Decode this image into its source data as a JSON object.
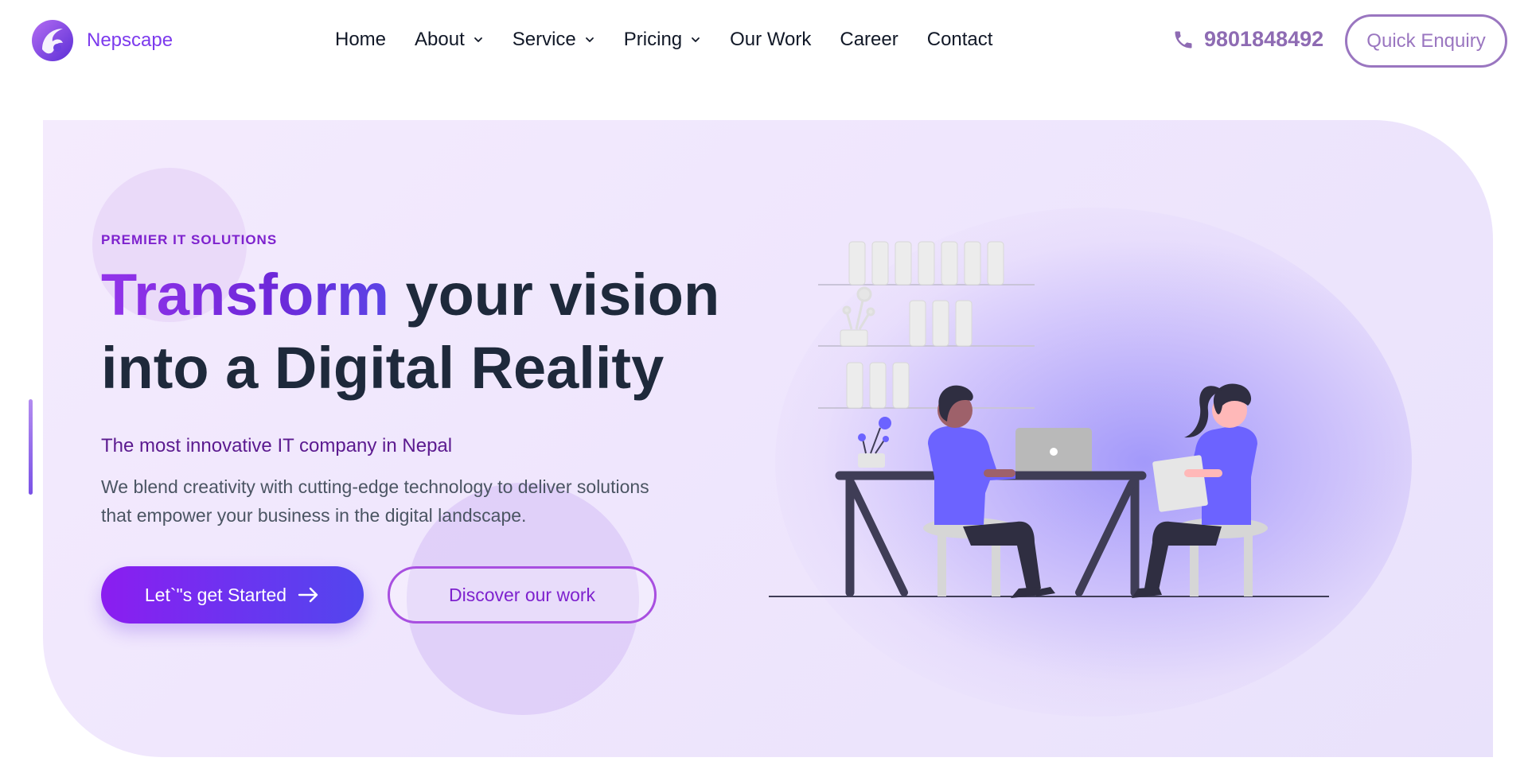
{
  "brand": {
    "name": "Nepscape",
    "accent": "#7c3aed"
  },
  "nav": {
    "items": [
      {
        "label": "Home",
        "has_dropdown": false
      },
      {
        "label": "About",
        "has_dropdown": true
      },
      {
        "label": "Service",
        "has_dropdown": true
      },
      {
        "label": "Pricing",
        "has_dropdown": true
      },
      {
        "label": "Our Work",
        "has_dropdown": false
      },
      {
        "label": "Career",
        "has_dropdown": false
      },
      {
        "label": "Contact",
        "has_dropdown": false
      }
    ]
  },
  "header": {
    "phone": "9801848492",
    "phone_icon": "phone-icon",
    "enquiry_label": "Quick Enquiry"
  },
  "hero": {
    "eyebrow": "PREMIER IT SOLUTIONS",
    "headline_highlight": "Transform",
    "headline_rest_1": "your vision",
    "headline_line_2": "into a Digital Reality",
    "subheading": "The most innovative IT company in Nepal",
    "description": "We blend creativity with cutting-edge technology to deliver solutions that empower your business in the digital landscape.",
    "primary_cta": "Let`\"s get Started",
    "primary_cta_icon": "arrow-right-icon",
    "secondary_cta": "Discover our work",
    "illustration": "people-working-at-desk-illustration"
  },
  "colors": {
    "primary_gradient_start": "#8b1df0",
    "primary_gradient_end": "#5246ee",
    "phone_color": "#8e6bb3",
    "hero_background": "#f1e8fd"
  }
}
